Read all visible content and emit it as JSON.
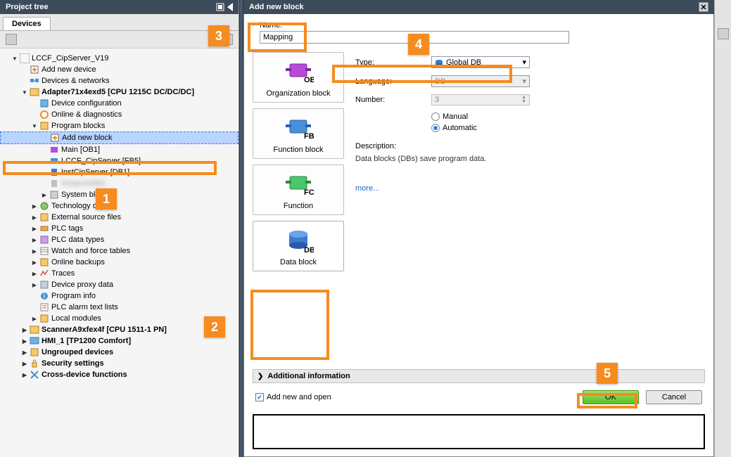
{
  "project_tree_title": "Project tree",
  "devices_tab": "Devices",
  "tree": {
    "root": "LCCF_CipServer_V19",
    "add_device": "Add new device",
    "devices_networks": "Devices & networks",
    "adapter": "Adapter71x4exd5 [CPU 1215C DC/DC/DC]",
    "device_config": "Device configuration",
    "online_diag": "Online & diagnostics",
    "program_blocks": "Program blocks",
    "add_new_block": "Add new block",
    "main": "Main [OB1]",
    "lccf": "LCCF_CipServer [FB5]",
    "inst": "InstCipServer [DB1]",
    "system_blocks": "System blocks",
    "tech_objects": "Technology objects",
    "ext_src": "External source files",
    "plc_tags": "PLC tags",
    "plc_dtypes": "PLC data types",
    "watch": "Watch and force tables",
    "backups": "Online backups",
    "traces": "Traces",
    "proxy": "Device proxy data",
    "prog_info": "Program info",
    "alarm": "PLC alarm text lists",
    "local_modules": "Local modules",
    "scanner": "ScannerA9xfex4f [CPU 1511-1 PN]",
    "hmi": "HMI_1 [TP1200 Comfort]",
    "ungrouped": "Ungrouped devices",
    "security": "Security settings",
    "cross": "Cross-device functions"
  },
  "dialog": {
    "title": "Add new block",
    "name_label": "Name:",
    "name_value": "Mapping",
    "type_label": "Type:",
    "type_value": "Global DB",
    "language_label": "Language:",
    "language_value": "DB",
    "number_label": "Number:",
    "number_value": "3",
    "manual": "Manual",
    "automatic": "Automatic",
    "desc_label": "Description:",
    "desc_text": "Data blocks (DBs) save program data.",
    "more": "more...",
    "additional": "Additional information",
    "add_open": "Add new and open",
    "ok": "OK",
    "cancel": "Cancel"
  },
  "tiles": {
    "ob": "Organization block",
    "fb": "Function block",
    "fc": "Function",
    "db": "Data block"
  },
  "annotations": {
    "a1": "1",
    "a2": "2",
    "a3": "3",
    "a4": "4",
    "a5": "5"
  }
}
